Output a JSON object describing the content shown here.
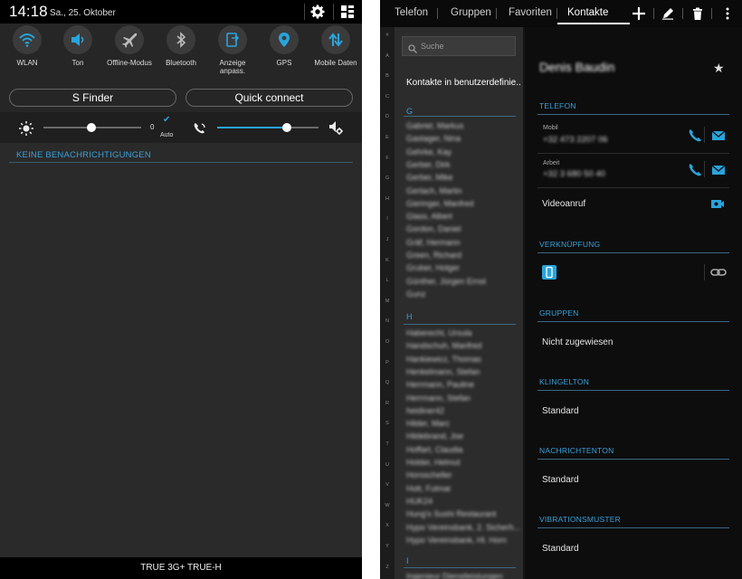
{
  "status_bar": {
    "time": "14:18",
    "date": "Sa., 25. Oktober"
  },
  "quick_settings": {
    "tiles": [
      {
        "label": "WLAN",
        "icon": "wifi-icon"
      },
      {
        "label": "Ton",
        "icon": "speaker-icon"
      },
      {
        "label": "Offline-Modus",
        "icon": "airplane-icon"
      },
      {
        "label": "Bluetooth",
        "icon": "bluetooth-icon"
      },
      {
        "label": "Anzeige anpass.",
        "icon": "display-icon"
      },
      {
        "label": "GPS",
        "icon": "location-icon"
      },
      {
        "label": "Mobile Daten",
        "icon": "mobile-data-icon"
      }
    ],
    "s_finder": "S Finder",
    "quick_connect": "Quick connect"
  },
  "sliders": {
    "brightness_value": "0",
    "auto_label": "Auto",
    "brightness_level": 0.49,
    "volume_level": 0.69
  },
  "notifications": {
    "empty_text": "KEINE BENACHRICHTIGUNGEN"
  },
  "carrier": "TRUE 3G+ TRUE-H",
  "contacts_app": {
    "tabs": [
      "Telefon",
      "Gruppen",
      "Favoriten",
      "Kontakte"
    ],
    "active_tab": "Kontakte",
    "search_placeholder": "Suche",
    "list_header": "Kontakte in benutzerdefinie..",
    "index_letters": [
      "#",
      "A",
      "B",
      "C",
      "D",
      "E",
      "F",
      "G",
      "H",
      "I",
      "J",
      "K",
      "L",
      "M",
      "N",
      "O",
      "P",
      "Q",
      "R",
      "S",
      "T",
      "U",
      "V",
      "W",
      "X",
      "Y",
      "Z"
    ],
    "sections": [
      {
        "letter": "G",
        "items": [
          "Gabriel, Markus",
          "Gastager, Nina",
          "Gehrke, Kay",
          "Gerber, Dirk",
          "Gerber, Mike",
          "Gerlach, Martin",
          "Gieringer, Manfred",
          "Glass, Albert",
          "Gordon, Daniel",
          "Gräf, Hermann",
          "Green, Richard",
          "Gruber, Holger",
          "Günther, Jürgen Ernst",
          "Gunz"
        ]
      },
      {
        "letter": "H",
        "items": [
          "Haberecht, Ursula",
          "Handschuh, Manfred",
          "Hankiewicz, Thomas",
          "Henkelmann, Stefan",
          "Herrmann, Pauline",
          "Herrmann, Stefan",
          "heidiner42",
          "Hilder, Marc",
          "Hildebrand, Joe",
          "Hoffart, Claudia",
          "Holder, Helmut",
          "Horoscheller",
          "Hott, Fulmar",
          "HUK24",
          "Hung's Sushi Restaurant",
          "Hypo Vereinsbank, 2. Sicherh...",
          "Hypo Vereinsbank, Hl. Horn"
        ]
      },
      {
        "letter": "I",
        "items": [
          "Ingenieur Dienstleistungen"
        ]
      }
    ],
    "detail": {
      "name": "Denis Baudin",
      "telefon_header": "TELEFON",
      "phones": [
        {
          "type": "Mobil",
          "number": "+32 473 2207 06"
        },
        {
          "type": "Arbeit",
          "number": "+32 3 680 50 40"
        }
      ],
      "video_call": "Videoanruf",
      "link_header": "VERKNÜPFUNG",
      "groups_header": "GRUPPEN",
      "groups_value": "Nicht zugewiesen",
      "ringtone_header": "KLINGELTON",
      "ringtone_value": "Standard",
      "msgtone_header": "NACHRICHTENTON",
      "msgtone_value": "Standard",
      "vibration_header": "VIBRATIONSMUSTER",
      "vibration_value": "Standard"
    }
  },
  "colors": {
    "accent": "#29a4dc",
    "panel_bg": "#2a2a2a",
    "list_bg": "#2c2c2c",
    "detail_bg": "#0d0d0d"
  }
}
